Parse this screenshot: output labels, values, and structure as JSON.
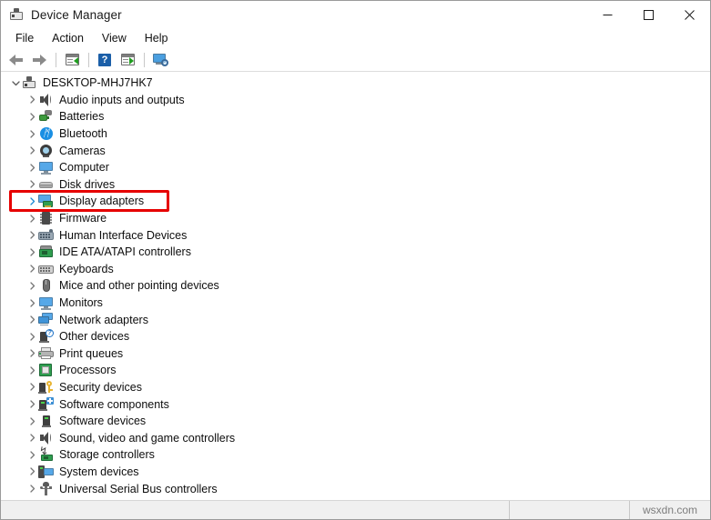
{
  "window": {
    "title": "Device Manager",
    "icon": "device-manager-icon",
    "controls": {
      "minimize": "minimize-icon",
      "maximize": "maximize-icon",
      "close": "close-icon"
    }
  },
  "menubar": {
    "items": [
      {
        "label": "File"
      },
      {
        "label": "Action"
      },
      {
        "label": "View"
      },
      {
        "label": "Help"
      }
    ]
  },
  "toolbar": {
    "buttons": [
      {
        "name": "back-icon",
        "type": "arrow-left"
      },
      {
        "name": "forward-icon",
        "type": "arrow-right"
      },
      {
        "name": "show-hide-console-tree-icon",
        "type": "window-green-left"
      },
      {
        "name": "help-icon",
        "type": "question",
        "glyph": "?"
      },
      {
        "name": "properties-icon",
        "type": "window-green-right"
      },
      {
        "name": "scan-for-hardware-changes-icon",
        "type": "monitor-scan"
      }
    ]
  },
  "tree": {
    "root": {
      "label": "DESKTOP-MHJ7HK7",
      "icon": "computer-icon",
      "expanded": true,
      "selected": true
    },
    "items": [
      {
        "label": "Audio inputs and outputs",
        "icon": "speaker-icon",
        "icon_class": "i-speaker"
      },
      {
        "label": "Batteries",
        "icon": "battery-icon",
        "icon_class": "i-batt"
      },
      {
        "label": "Bluetooth",
        "icon": "bluetooth-icon",
        "icon_class": "i-bt"
      },
      {
        "label": "Cameras",
        "icon": "camera-icon",
        "icon_class": "i-cam"
      },
      {
        "label": "Computer",
        "icon": "monitor-icon",
        "icon_class": "i-mon"
      },
      {
        "label": "Disk drives",
        "icon": "disk-drive-icon",
        "icon_class": "i-disk"
      },
      {
        "label": "Display adapters",
        "icon": "display-adapter-icon",
        "icon_class": "i-disp",
        "highlighted": true
      },
      {
        "label": "Firmware",
        "icon": "firmware-chip-icon",
        "icon_class": "i-fw"
      },
      {
        "label": "Human Interface Devices",
        "icon": "hid-icon",
        "icon_class": "i-hid"
      },
      {
        "label": "IDE ATA/ATAPI controllers",
        "icon": "ide-controller-icon",
        "icon_class": "i-ide"
      },
      {
        "label": "Keyboards",
        "icon": "keyboard-icon",
        "icon_class": "i-kb"
      },
      {
        "label": "Mice and other pointing devices",
        "icon": "mouse-icon",
        "icon_class": "i-mouse"
      },
      {
        "label": "Monitors",
        "icon": "monitor-icon",
        "icon_class": "i-mon"
      },
      {
        "label": "Network adapters",
        "icon": "network-adapter-icon",
        "icon_class": "i-net"
      },
      {
        "label": "Other devices",
        "icon": "unknown-device-icon",
        "icon_class": "i-other"
      },
      {
        "label": "Print queues",
        "icon": "printer-icon",
        "icon_class": "i-print"
      },
      {
        "label": "Processors",
        "icon": "processor-icon",
        "icon_class": "i-cpu"
      },
      {
        "label": "Security devices",
        "icon": "security-device-icon",
        "icon_class": "i-sec"
      },
      {
        "label": "Software components",
        "icon": "software-component-icon",
        "icon_class": "i-swc"
      },
      {
        "label": "Software devices",
        "icon": "software-device-icon",
        "icon_class": "i-swd"
      },
      {
        "label": "Sound, video and game controllers",
        "icon": "speaker-icon",
        "icon_class": "i-speaker"
      },
      {
        "label": "Storage controllers",
        "icon": "storage-controller-icon",
        "icon_class": "i-stor"
      },
      {
        "label": "System devices",
        "icon": "system-device-icon",
        "icon_class": "i-sys"
      },
      {
        "label": "Universal Serial Bus controllers",
        "icon": "usb-controller-icon",
        "icon_class": "i-usb"
      }
    ]
  },
  "annotation": {
    "type": "red-rectangle",
    "target": "Display adapters",
    "color": "#e60000"
  },
  "statusbar": {
    "pane1": "",
    "pane2": "",
    "watermark": "wsxdn.com"
  },
  "colors": {
    "selection": "#cbe8ff",
    "annotation": "#e60000",
    "accent_blue": "#1a8fe3",
    "window_bg": "#ffffff",
    "statusbar_bg": "#f0f0f0"
  }
}
